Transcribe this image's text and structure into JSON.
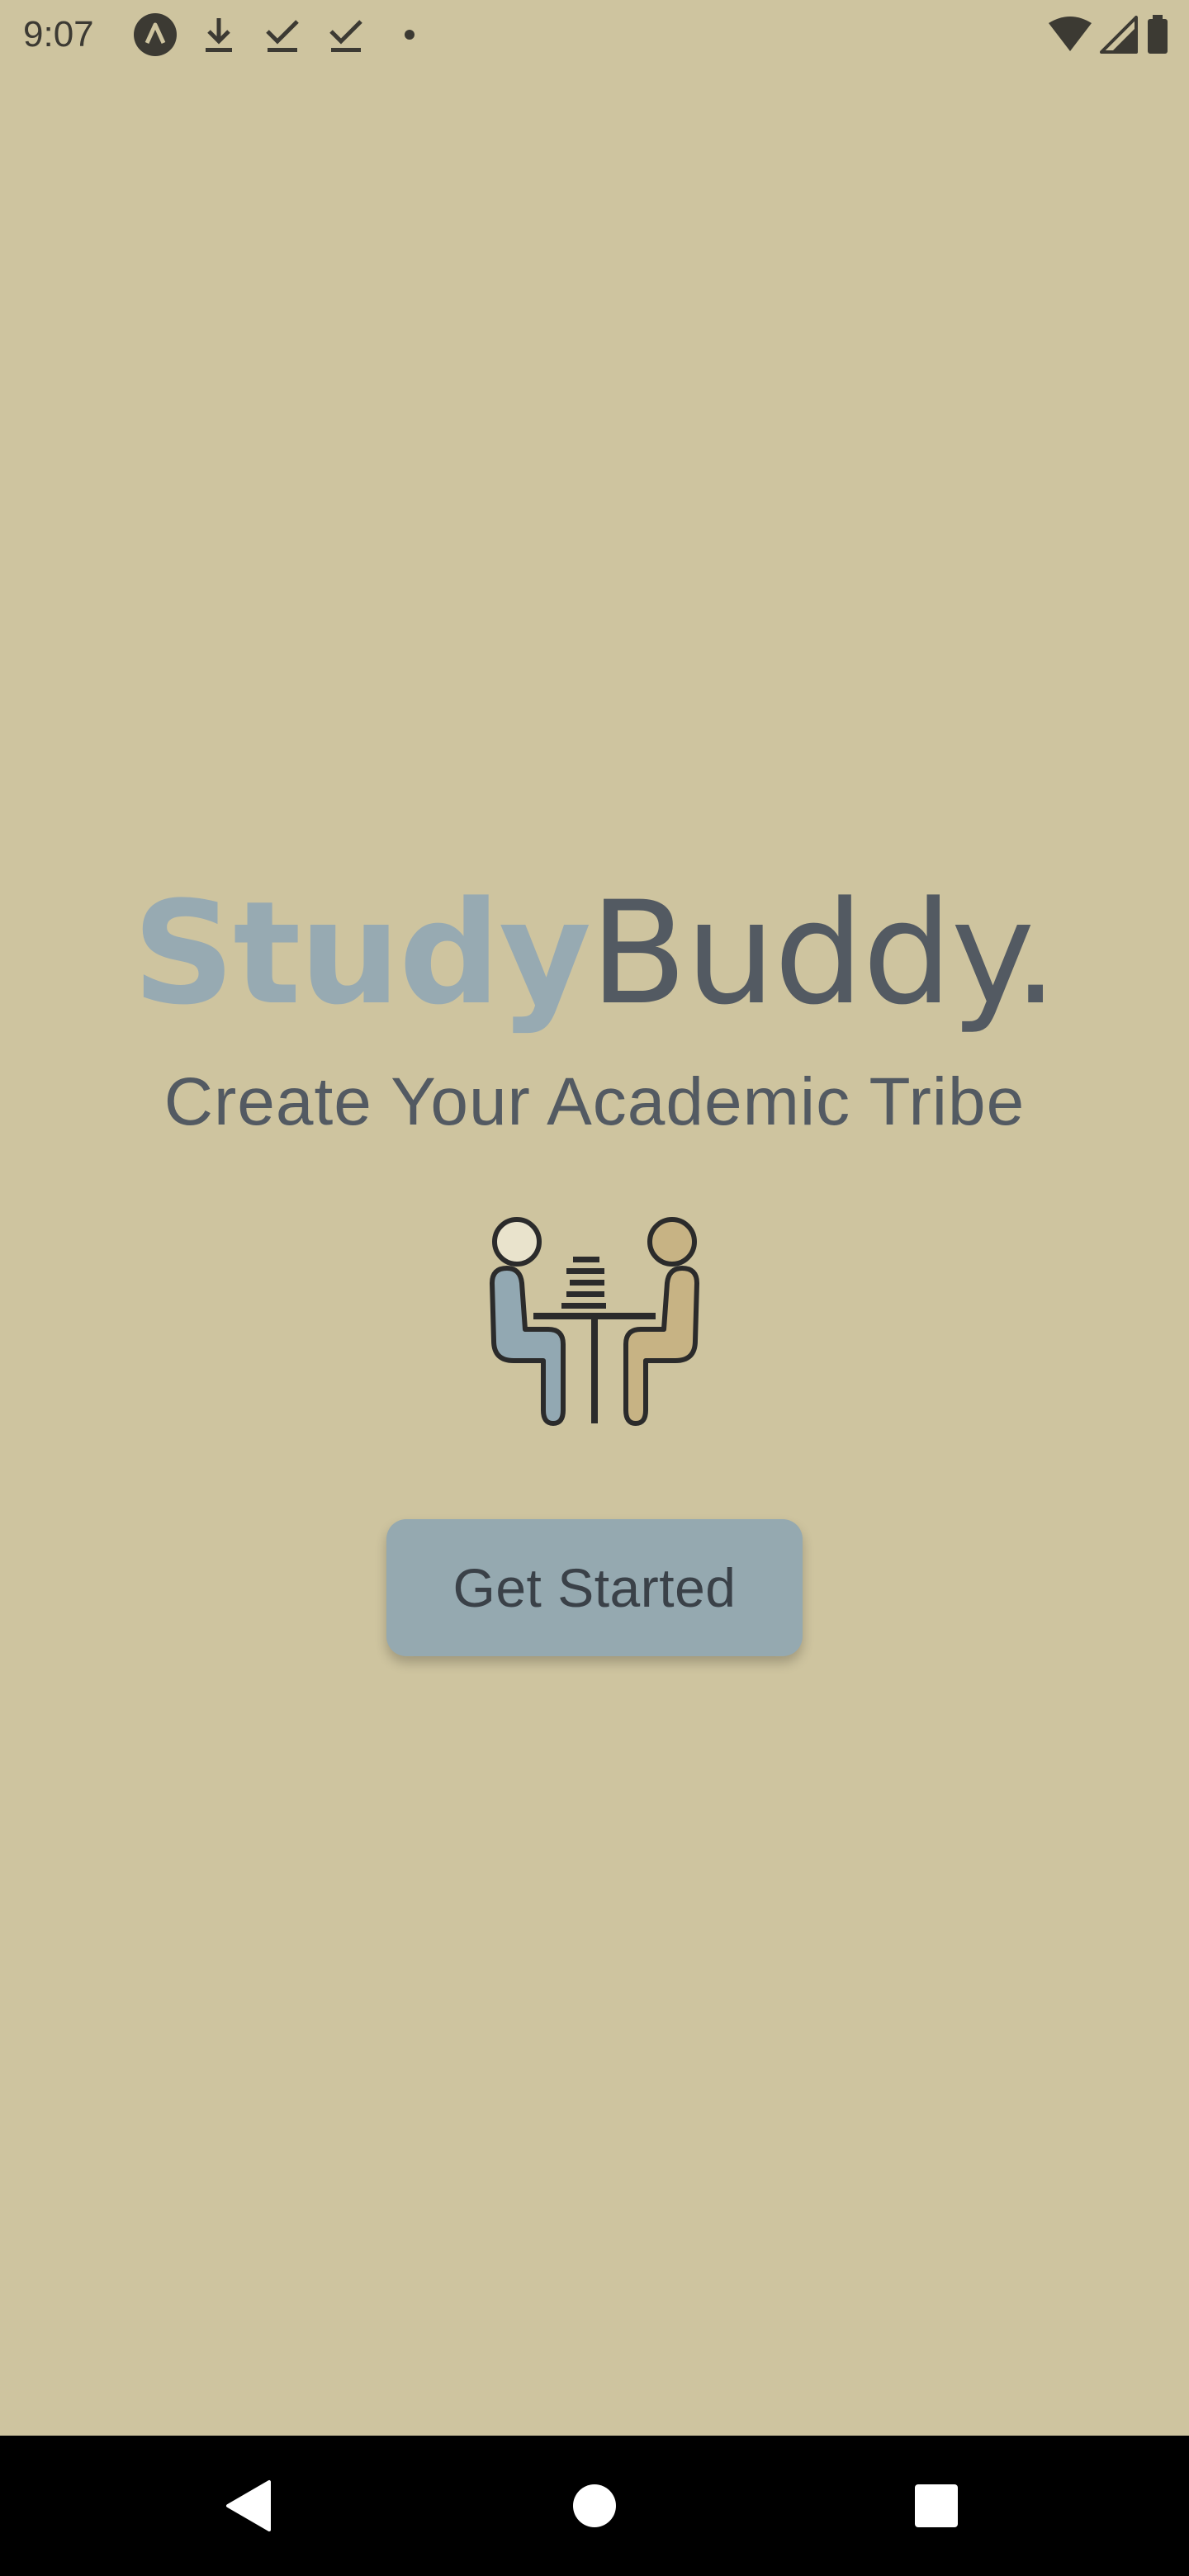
{
  "status_bar": {
    "time": "9:07",
    "left_icons": [
      "app-notification-icon",
      "download-icon",
      "done-icon",
      "done-icon",
      "dot-icon"
    ],
    "right_icons": [
      "wifi-icon",
      "cell-signal-icon",
      "battery-icon"
    ]
  },
  "main": {
    "title_part1": "Study",
    "title_part2": "Buddy.",
    "tagline": "Create Your Academic Tribe",
    "illustration_icon": "two-people-studying-at-table-icon",
    "cta_label": "Get Started"
  },
  "nav_bar": {
    "buttons": [
      "back-icon",
      "home-icon",
      "recents-icon"
    ]
  },
  "colors": {
    "background": "#cec49f",
    "accent_blue": "#97aab2",
    "text_dark": "#535a62",
    "figure_tan": "#c7b384",
    "button_bg": "#95a9b0"
  }
}
